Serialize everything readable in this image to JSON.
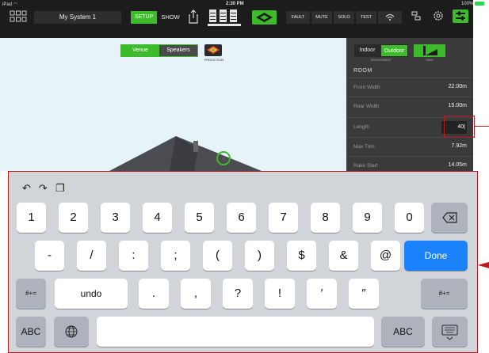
{
  "status_bar": {
    "device": "iPad",
    "time": "2:30 PM",
    "battery": "100%"
  },
  "topbar": {
    "system_name": "My System 1",
    "setup_label": "SETUP",
    "show_label": "SHOW",
    "nav": [
      "FAULT",
      "MUTE",
      "SOLO",
      "TEST"
    ]
  },
  "canvas": {
    "segment": {
      "active": "Venue",
      "inactive": "Speakers"
    },
    "prediction_label": "PREDICTION"
  },
  "panel": {
    "env_indoor": "Indoor",
    "env_outdoor": "Outdoor",
    "env_label": "ENVIRONMENT",
    "rake_label": "RAKE",
    "room_title": "ROOM",
    "rows": [
      {
        "label": "Front Width",
        "value": "22.00m"
      },
      {
        "label": "Rear Width",
        "value": "15.00m"
      },
      {
        "label": "Length",
        "value": "40"
      },
      {
        "label": "Max Trim",
        "value": "7.92m"
      },
      {
        "label": "Rake Start",
        "value": "14.05m"
      }
    ]
  },
  "keyboard": {
    "row1": [
      "1",
      "2",
      "3",
      "4",
      "5",
      "6",
      "7",
      "8",
      "9",
      "0"
    ],
    "row2": [
      "-",
      "/",
      ":",
      ";",
      "(",
      ")",
      "$",
      "&",
      "@"
    ],
    "done": "Done",
    "symbols_toggle": "#+=",
    "undo": "undo",
    "row3": [
      ".",
      ",",
      "?",
      "!",
      "′",
      "″"
    ],
    "abc": "ABC"
  },
  "colors": {
    "accent": "#3dbb2a",
    "highlight": "#c0181f",
    "done_blue": "#1a82fb"
  }
}
